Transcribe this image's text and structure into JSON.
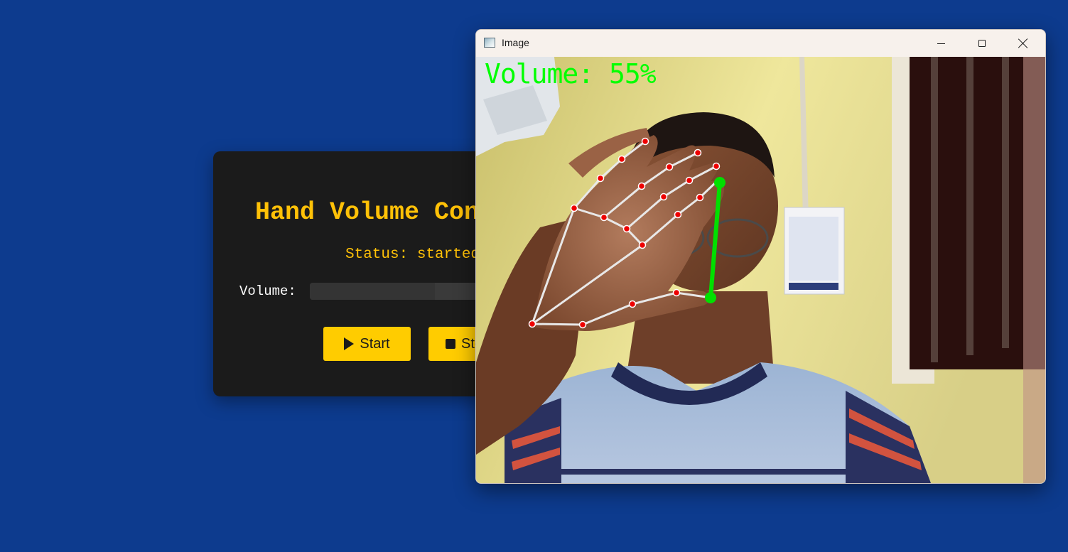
{
  "app": {
    "title": "Hand Volume Control",
    "status_text": "Status: started",
    "volume_label": "Volume:",
    "volume_level": 0.55,
    "buttons": {
      "start": "Start",
      "stop": "Stop"
    },
    "icons": {
      "start": "play-icon",
      "stop": "stop-icon"
    },
    "colors": {
      "accent": "#ffc107",
      "button": "#ffcc00",
      "panel": "#1b1b1b",
      "page_background": "#0d3b8e"
    }
  },
  "image_window": {
    "title": "Image",
    "icon": "image-window-icon",
    "controls": [
      "minimize-icon",
      "maximize-icon",
      "close-icon"
    ],
    "overlay_text": "Volume: 55%",
    "overlay_color": "#00ff00",
    "landmark_color": "#ff0000",
    "connection_color": "#e8e8e8"
  }
}
